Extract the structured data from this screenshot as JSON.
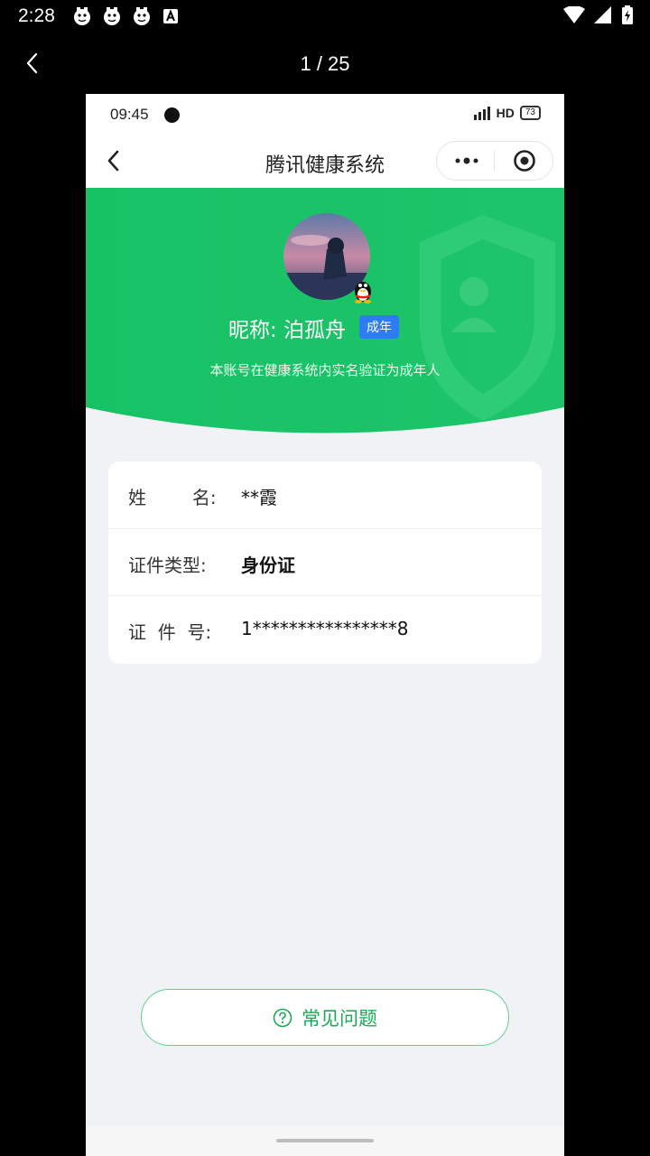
{
  "system": {
    "time": "2:28",
    "notif_icons": [
      "notification-app-icon",
      "notification-app-icon",
      "notification-app-icon",
      "a-icon"
    ]
  },
  "viewer": {
    "counter": "1 / 25"
  },
  "phone": {
    "status": {
      "time": "09:45",
      "network": "HD",
      "battery": "73"
    },
    "nav": {
      "title": "腾讯健康系统"
    },
    "profile": {
      "nickname": "昵称: 泊孤舟",
      "tag": "成年",
      "subtitle": "本账号在健康系统内实名验证为成年人"
    },
    "info": [
      {
        "label": "姓        名:",
        "value": "**霞"
      },
      {
        "label": "证件类型:",
        "value": "身份证"
      },
      {
        "label": "证  件  号:",
        "value": "1****************8"
      }
    ],
    "faq": {
      "label": "常见问题"
    }
  },
  "colors": {
    "accent_green": "#1ec46a",
    "tag_blue": "#2d7cf6"
  }
}
